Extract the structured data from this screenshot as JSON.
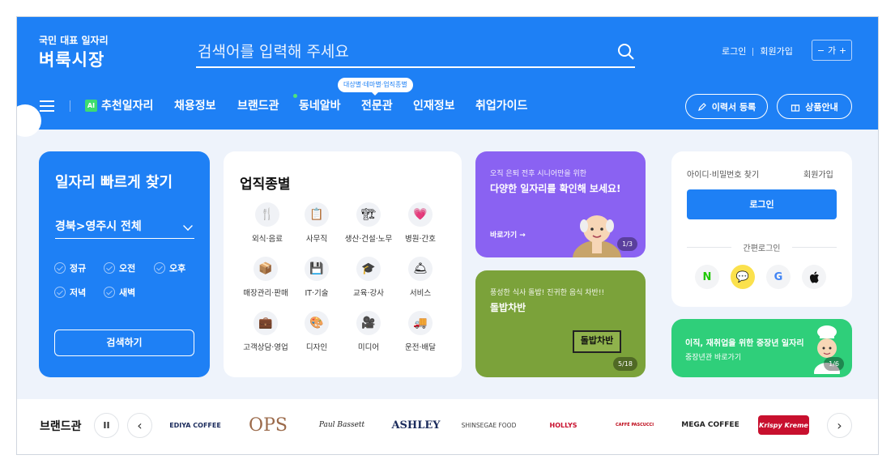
{
  "header": {
    "logo_sub": "국민 대표 일자리",
    "logo_main": "벼룩시장",
    "search_placeholder": "검색어를 입력해 주세요",
    "login": "로그인",
    "signup": "회원가입",
    "font_minus": "−",
    "font_label": "가",
    "font_plus": "+"
  },
  "nav": {
    "ai_badge": "AI",
    "items": [
      "추천일자리",
      "채용정보",
      "브랜드관",
      "동네알바",
      "전문관",
      "인재정보",
      "취업가이드"
    ],
    "tooltip": "대상별·테마별·업직종별",
    "resume_btn": "이력서 등록",
    "product_btn": "상품안내"
  },
  "quick": {
    "title": "일자리 빠르게 찾기",
    "region": "경북>영주시 전체",
    "checks": [
      "정규",
      "오전",
      "오후",
      "저녁",
      "새벽"
    ],
    "search_btn": "검색하기"
  },
  "jobs": {
    "title": "업직종별",
    "categories": [
      {
        "label": "외식·음료",
        "icon": "🍴"
      },
      {
        "label": "사무직",
        "icon": "📋"
      },
      {
        "label": "생산·건설·노무",
        "icon": "🏗"
      },
      {
        "label": "병원·간호",
        "icon": "💗"
      },
      {
        "label": "매장관리·판매",
        "icon": "📦"
      },
      {
        "label": "IT·기술",
        "icon": "💾"
      },
      {
        "label": "교육·강사",
        "icon": "🎓"
      },
      {
        "label": "서비스",
        "icon": "🛎"
      },
      {
        "label": "고객상담·영업",
        "icon": "💼"
      },
      {
        "label": "디자인",
        "icon": "🎨"
      },
      {
        "label": "미디어",
        "icon": "🎥"
      },
      {
        "label": "운전·배달",
        "icon": "🚚"
      }
    ]
  },
  "promo1": {
    "sub": "오직 은퇴 전후 시니어만을 위한",
    "title": "다양한 일자리를 확인해 보세요!",
    "link": "바로가기 →",
    "counter": "1/3",
    "color": "#8a62f2"
  },
  "promo2": {
    "sub": "풍성한 식사 돌밥! 진귀한 음식 차반!!",
    "title": "돌밥차반",
    "sign": "돌밥차반",
    "counter": "5/18",
    "color": "#7ba23a"
  },
  "login_card": {
    "find": "아이디·비밀번호 찾기",
    "signup": "회원가입",
    "login_btn": "로그인",
    "simple": "간편로그인",
    "socials": [
      "N",
      "💬",
      "G",
      ""
    ]
  },
  "senior": {
    "t1": "이직, 재취업을 위한 중장년 일자리",
    "t2": "중장년관 바로가기",
    "counter": "1/6"
  },
  "brands": {
    "title": "브랜드관",
    "pause": "II",
    "prev": "‹",
    "next": "›",
    "items": [
      "EDIYA COFFEE",
      "OPS",
      "Paul Bassett",
      "ASHLEY",
      "SHINSEGAE FOOD",
      "HOLLYS",
      "CAFFÉ PASCUCCI",
      "MEGA COFFEE",
      "Krispy Kreme"
    ]
  },
  "colors": {
    "primary": "#1e80f5",
    "purple": "#8a62f2",
    "olive": "#7ba23a",
    "green": "#2fcf7a"
  }
}
